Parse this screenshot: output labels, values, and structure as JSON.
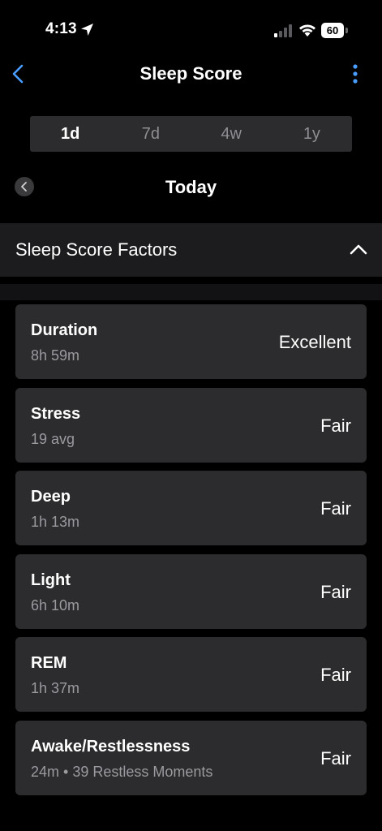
{
  "status_bar": {
    "time": "4:13",
    "battery": "60"
  },
  "nav": {
    "title": "Sleep Score"
  },
  "range_tabs": [
    {
      "label": "1d",
      "selected": true
    },
    {
      "label": "7d",
      "selected": false
    },
    {
      "label": "4w",
      "selected": false
    },
    {
      "label": "1y",
      "selected": false
    }
  ],
  "date": {
    "label": "Today"
  },
  "section": {
    "title": "Sleep Score Factors",
    "expanded": true
  },
  "factors": [
    {
      "name": "Duration",
      "detail": "8h 59m",
      "rating": "Excellent"
    },
    {
      "name": "Stress",
      "detail": "19 avg",
      "rating": "Fair"
    },
    {
      "name": "Deep",
      "detail": "1h 13m",
      "rating": "Fair"
    },
    {
      "name": "Light",
      "detail": "6h 10m",
      "rating": "Fair"
    },
    {
      "name": "REM",
      "detail": "1h 37m",
      "rating": "Fair"
    },
    {
      "name": "Awake/Restlessness",
      "detail": "24m • 39 Restless Moments",
      "rating": "Fair"
    }
  ],
  "colors": {
    "accent": "#4a9eff",
    "background": "#000000",
    "card": "#2c2c2e",
    "secondary_text": "#9a9a9f"
  }
}
